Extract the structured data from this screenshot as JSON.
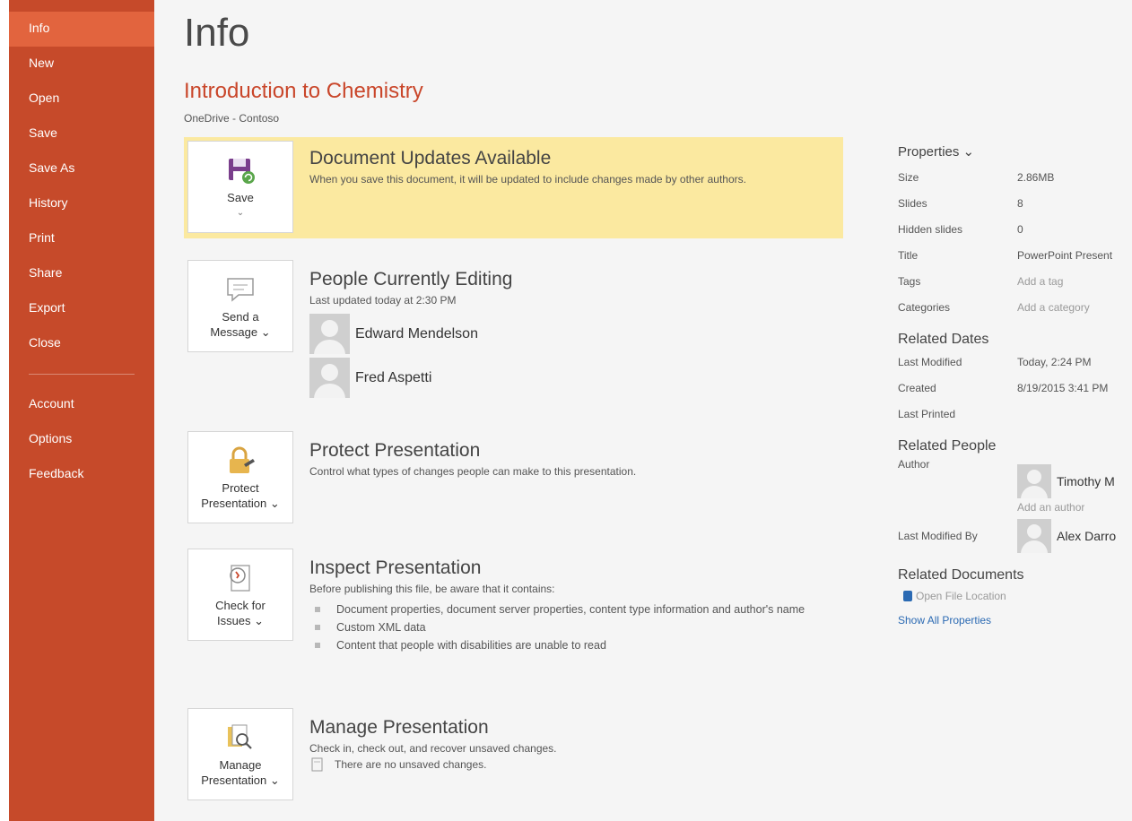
{
  "sidebar": {
    "items": [
      {
        "label": "Info",
        "active": true
      },
      {
        "label": "New"
      },
      {
        "label": "Open"
      },
      {
        "label": "Save"
      },
      {
        "label": "Save As"
      },
      {
        "label": "History"
      },
      {
        "label": "Print"
      },
      {
        "label": "Share"
      },
      {
        "label": "Export"
      },
      {
        "label": "Close"
      }
    ],
    "items2": [
      {
        "label": "Account"
      },
      {
        "label": "Options"
      },
      {
        "label": "Feedback"
      }
    ]
  },
  "page": {
    "title": "Info",
    "doc_title": "Introduction to Chemistry",
    "doc_location": "OneDrive - Contoso"
  },
  "sections": {
    "updates": {
      "tile_label": "Save",
      "tile_caret": "⌄",
      "title": "Document Updates Available",
      "desc": "When you save this document, it will be updated to include changes made by other authors."
    },
    "editing": {
      "tile_label": "Send a",
      "tile_label2": "Message ⌄",
      "title": "People Currently Editing",
      "desc": "Last updated today at 2:30 PM",
      "people": [
        "Edward Mendelson",
        "Fred Aspetti"
      ]
    },
    "protect": {
      "tile_label": "Protect",
      "tile_label2": "Presentation ⌄",
      "title": "Protect Presentation",
      "desc": "Control what types of changes people can make to this presentation."
    },
    "inspect": {
      "tile_label": "Check for",
      "tile_label2": "Issues ⌄",
      "title": "Inspect Presentation",
      "desc": "Before publishing this file, be aware that it contains:",
      "bullets": [
        "Document properties, document server properties, content type information and author's name",
        "Custom XML data",
        "Content that people with disabilities are unable to read"
      ]
    },
    "manage": {
      "tile_label": "Manage",
      "tile_label2": "Presentation ⌄",
      "title": "Manage Presentation",
      "desc": "Check in, check out, and recover unsaved changes.",
      "note": "There are no unsaved changes."
    }
  },
  "properties": {
    "heading": "Properties ⌄",
    "rows": [
      {
        "label": "Size",
        "value": "2.86MB"
      },
      {
        "label": "Slides",
        "value": "8"
      },
      {
        "label": "Hidden slides",
        "value": "0"
      },
      {
        "label": "Title",
        "value": "PowerPoint Present"
      },
      {
        "label": "Tags",
        "value": "Add a tag",
        "placeholder": true
      },
      {
        "label": "Categories",
        "value": "Add a category",
        "placeholder": true
      }
    ],
    "related_dates_title": "Related Dates",
    "dates": [
      {
        "label": "Last Modified",
        "value": "Today, 2:24 PM"
      },
      {
        "label": "Created",
        "value": "8/19/2015 3:41 PM"
      },
      {
        "label": "Last Printed",
        "value": ""
      }
    ],
    "related_people_title": "Related People",
    "author_label": "Author",
    "author_name": "Timothy M",
    "add_author": "Add an author",
    "last_modified_by_label": "Last Modified By",
    "last_modified_by_name": "Alex Darro",
    "related_docs_title": "Related Documents",
    "open_file_location": "Open File Location",
    "show_all": "Show All Properties"
  }
}
